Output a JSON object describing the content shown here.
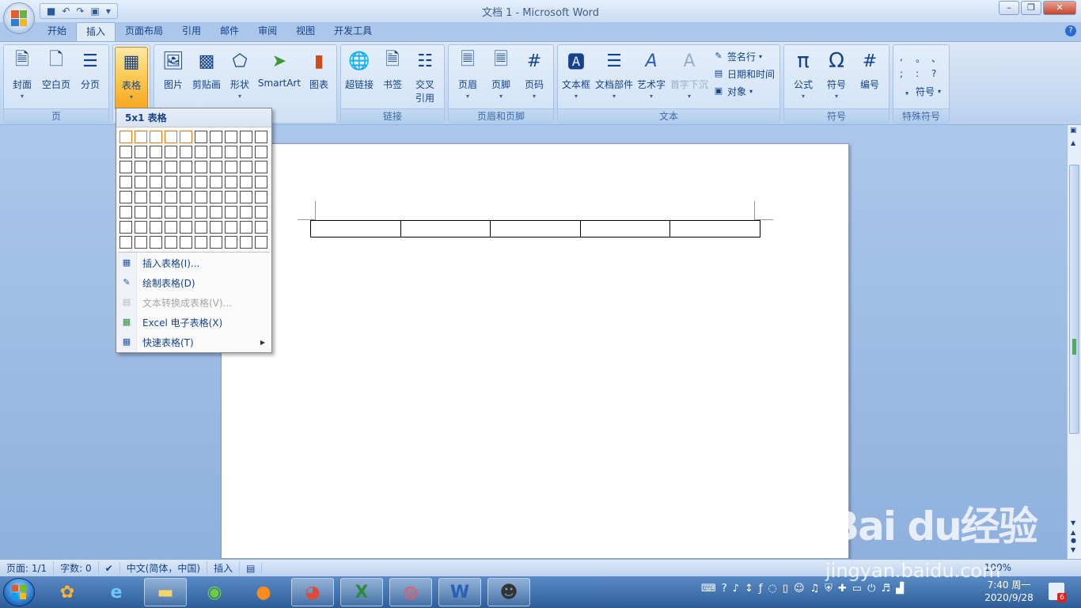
{
  "window": {
    "title": "文档 1 - Microsoft Word"
  },
  "qat": {
    "save": "save-icon",
    "undo": "↶",
    "redo": "↷",
    "more": "▾"
  },
  "tabs": [
    "开始",
    "插入",
    "页面布局",
    "引用",
    "邮件",
    "审阅",
    "视图",
    "开发工具"
  ],
  "ribbon": {
    "groups": {
      "page": {
        "label": "页",
        "buttons": [
          "封面",
          "空白页",
          "分页"
        ]
      },
      "table": {
        "button": "表格"
      },
      "illustrations": {
        "buttons": [
          "图片",
          "剪贴画",
          "形状",
          "SmartArt",
          "图表"
        ]
      },
      "links": {
        "label": "链接",
        "buttons": [
          "超链接",
          "书签",
          "交叉",
          "引用"
        ]
      },
      "header_footer": {
        "label": "页眉和页脚",
        "buttons": [
          "页眉",
          "页脚",
          "页码"
        ]
      },
      "text": {
        "label": "文本",
        "buttons": [
          "文本框",
          "文档部件",
          "艺术字",
          "首字下沉"
        ],
        "small": [
          "签名行",
          "日期和时间",
          "对象"
        ]
      },
      "symbols": {
        "label": "符号",
        "buttons": [
          "公式",
          "符号",
          "编号"
        ]
      },
      "special": {
        "label": "特殊符号",
        "chars": [
          ",",
          "。",
          "、",
          ";",
          ":",
          "?"
        ],
        "button": "符号"
      }
    }
  },
  "dropdown": {
    "header": "5x1 表格",
    "grid": {
      "cols": 10,
      "rows": 8,
      "highlight_cols": 5,
      "highlight_rows": 1
    },
    "items": [
      {
        "label": "插入表格(I)...",
        "disabled": false
      },
      {
        "label": "绘制表格(D)",
        "disabled": false
      },
      {
        "label": "文本转换成表格(V)...",
        "disabled": true
      },
      {
        "label": "Excel 电子表格(X)",
        "disabled": false
      },
      {
        "label": "快速表格(T)",
        "disabled": false,
        "submenu": true
      }
    ]
  },
  "document": {
    "table_columns": 5
  },
  "status": {
    "page": "页面: 1/1",
    "words": "字数: 0",
    "lang": "中文(简体，中国)",
    "mode": "插入",
    "zoom": "100%"
  },
  "taskbar": {
    "time": "7:40 周一",
    "date": "2020/9/28",
    "badge": "6"
  },
  "watermark": {
    "main": "Bai du经验",
    "sub": "jingyan.baidu.com"
  }
}
